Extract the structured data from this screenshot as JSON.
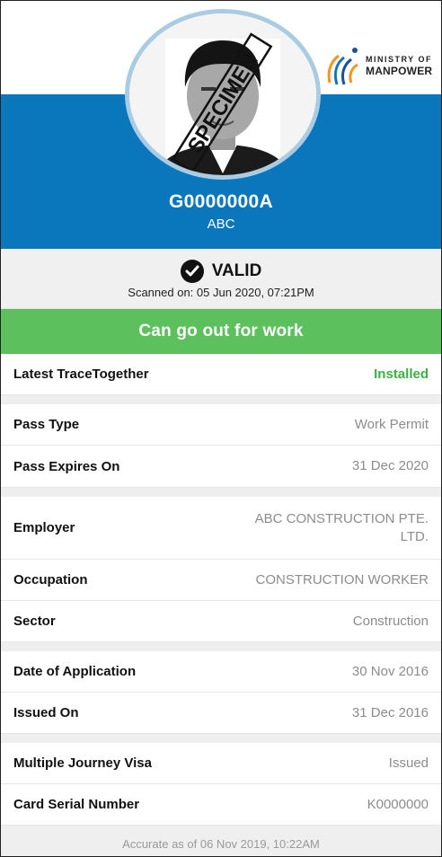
{
  "logo": {
    "line1": "MINISTRY OF",
    "line2": "MANPOWER"
  },
  "photo": {
    "watermark": "SPECIMEN"
  },
  "pass": {
    "id": "G0000000A",
    "name": "ABC"
  },
  "status": {
    "label": "VALID",
    "scanned": "Scanned on: 05 Jun 2020, 07:21PM"
  },
  "banner": {
    "text": "Can go out for work"
  },
  "trace": {
    "label": "Latest TraceTogether",
    "value": "Installed"
  },
  "pass_details": [
    {
      "label": "Pass Type",
      "value": "Work Permit"
    },
    {
      "label": "Pass Expires On",
      "value": "31 Dec 2020"
    }
  ],
  "employment": [
    {
      "label": "Employer",
      "value": "ABC CONSTRUCTION PTE. LTD."
    },
    {
      "label": "Occupation",
      "value": "CONSTRUCTION WORKER"
    },
    {
      "label": "Sector",
      "value": "Construction"
    }
  ],
  "application": [
    {
      "label": "Date of Application",
      "value": "30 Nov 2016"
    },
    {
      "label": "Issued On",
      "value": "31 Dec 2016"
    }
  ],
  "visa": [
    {
      "label": "Multiple Journey Visa",
      "value": "Issued"
    },
    {
      "label": "Card Serial Number",
      "value": "K0000000"
    }
  ],
  "footer": {
    "text": "Accurate as of 06 Nov 2019, 10:22AM"
  },
  "colors": {
    "header_blue": "#0a76bc",
    "banner_green": "#5cc05c",
    "installed_green": "#3cb043",
    "ring": "#a9cce3"
  },
  "icons": {
    "status": "check-circle-icon",
    "logo": "mom-logo-icon"
  }
}
